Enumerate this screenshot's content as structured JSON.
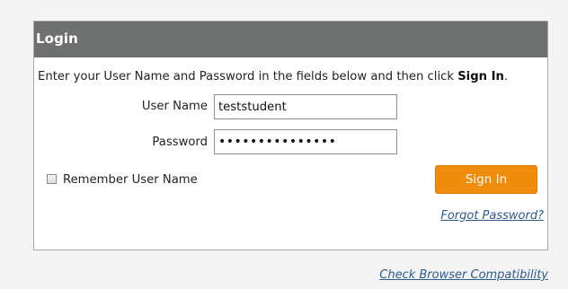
{
  "login": {
    "title": "Login",
    "instructions_prefix": "Enter your User Name and Password in the fields below and then click ",
    "instructions_action": "Sign In",
    "instructions_suffix": ".",
    "username_label": "User Name",
    "username_value": "teststudent",
    "password_label": "Password",
    "password_masked": "•••••••••••••••",
    "remember_label": "Remember User Name",
    "remember_checked": false,
    "signin_label": "Sign In",
    "forgot_label": "Forgot Password?"
  },
  "footer": {
    "compat_label": "Check Browser Compatibility"
  },
  "colors": {
    "header_bg": "#6f7070",
    "button_bg": "#ef8c0b",
    "link": "#2b5a8d"
  }
}
